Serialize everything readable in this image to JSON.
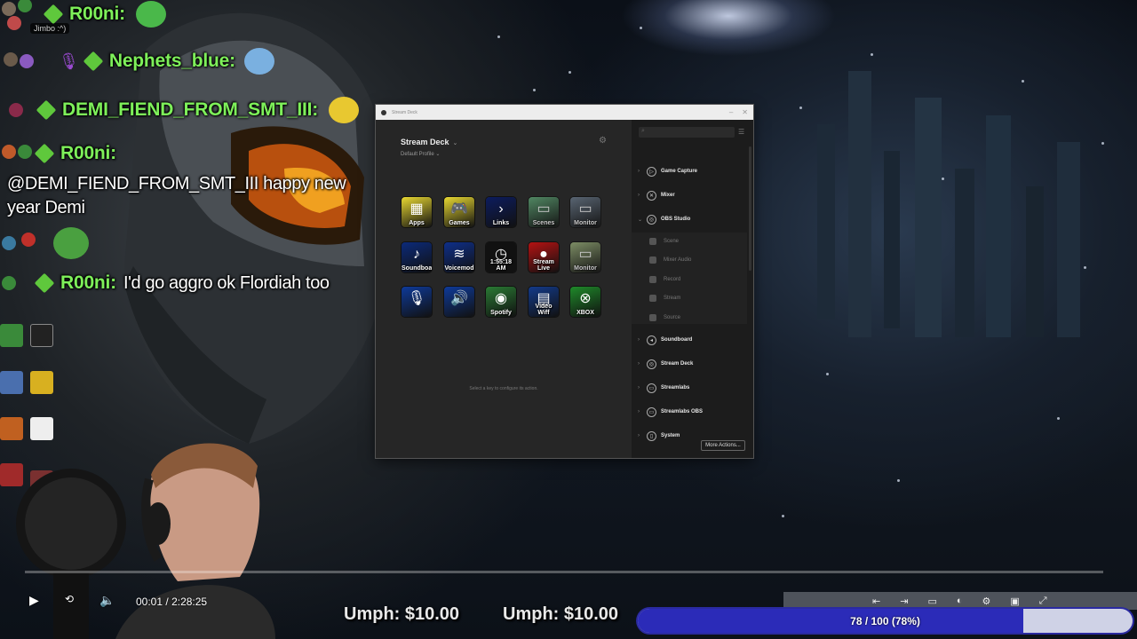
{
  "chat": {
    "jimbo_tag": "Jimbo :^)",
    "messages": [
      {
        "user": "R00ni:",
        "text": ""
      },
      {
        "user": "Nephets_blue:",
        "text": ""
      },
      {
        "user": "DEMI_FIEND_FROM_SMT_III:",
        "text": ""
      },
      {
        "user": "R00ni:",
        "text": "@DEMI_FIEND_FROM_SMT_III happy new year Demi"
      },
      {
        "user": "R00ni:",
        "text": "I'd go aggro ok Flordiah too"
      }
    ]
  },
  "stream_deck": {
    "window_title": "Stream Deck",
    "device": "Stream Deck",
    "profile": "Default Profile",
    "hint": "Select a key to configure its action.",
    "keys": [
      {
        "label": "Apps",
        "glyph": "▦",
        "bg": "#e8d832"
      },
      {
        "label": "Games",
        "glyph": "🎮",
        "bg": "#e8d832"
      },
      {
        "label": "Links",
        "glyph": "›",
        "bg": "#0c1c5e"
      },
      {
        "label": "Scenes",
        "glyph": "▭",
        "bg": "#5fa877"
      },
      {
        "label": "Monitor",
        "glyph": "▭",
        "bg": "#6a7a8c"
      },
      {
        "label": "Soundboard",
        "glyph": "♪",
        "bg": "#0b2a7a"
      },
      {
        "label": "Voicemod",
        "glyph": "≋",
        "bg": "#0e2f8a"
      },
      {
        "label": "1:55:18 AM",
        "glyph": "◷",
        "bg": "#111111"
      },
      {
        "label": "Stream Live",
        "glyph": "●",
        "bg": "#b51212"
      },
      {
        "label": "Monitor",
        "glyph": "▭",
        "bg": "#9ab07a"
      },
      {
        "label": "",
        "glyph": "🎙",
        "bg": "#0e3a9a"
      },
      {
        "label": "",
        "glyph": "🔊",
        "bg": "#0e3a9a"
      },
      {
        "label": "Spotify",
        "glyph": "◉",
        "bg": "#2a7a34"
      },
      {
        "label": "Video Wiff",
        "glyph": "▤",
        "bg": "#133a8a"
      },
      {
        "label": "XBOX",
        "glyph": "⊗",
        "bg": "#1f8a2a"
      }
    ],
    "search_placeholder": "Search",
    "categories": [
      {
        "label": "Game Capture",
        "icon": "▷"
      },
      {
        "label": "Mixer",
        "icon": "✕"
      },
      {
        "label": "OBS Studio",
        "icon": "◎"
      },
      {
        "label": "Soundboard",
        "icon": "◂"
      },
      {
        "label": "Stream Deck",
        "icon": "◎"
      },
      {
        "label": "Streamlabs",
        "icon": "▭"
      },
      {
        "label": "Streamlabs OBS",
        "icon": "▭"
      },
      {
        "label": "System",
        "icon": "▯"
      }
    ],
    "obs_subitems": [
      "Scene",
      "Mixer Audio",
      "Record",
      "Stream",
      "Source"
    ],
    "more_actions": "More Actions..."
  },
  "player": {
    "current_time": "00:01",
    "separator": "/",
    "duration": "2:28:25",
    "progress": 0.0
  },
  "alerts": {
    "umph_1": "Umph: $10.00",
    "umph_2": "Umph: $10.00"
  },
  "goal": {
    "text": "78 / 100 (78%)",
    "current": 78,
    "target": 100,
    "fill_color": "#2b2bb8",
    "track_color": "#cfd2e6"
  }
}
